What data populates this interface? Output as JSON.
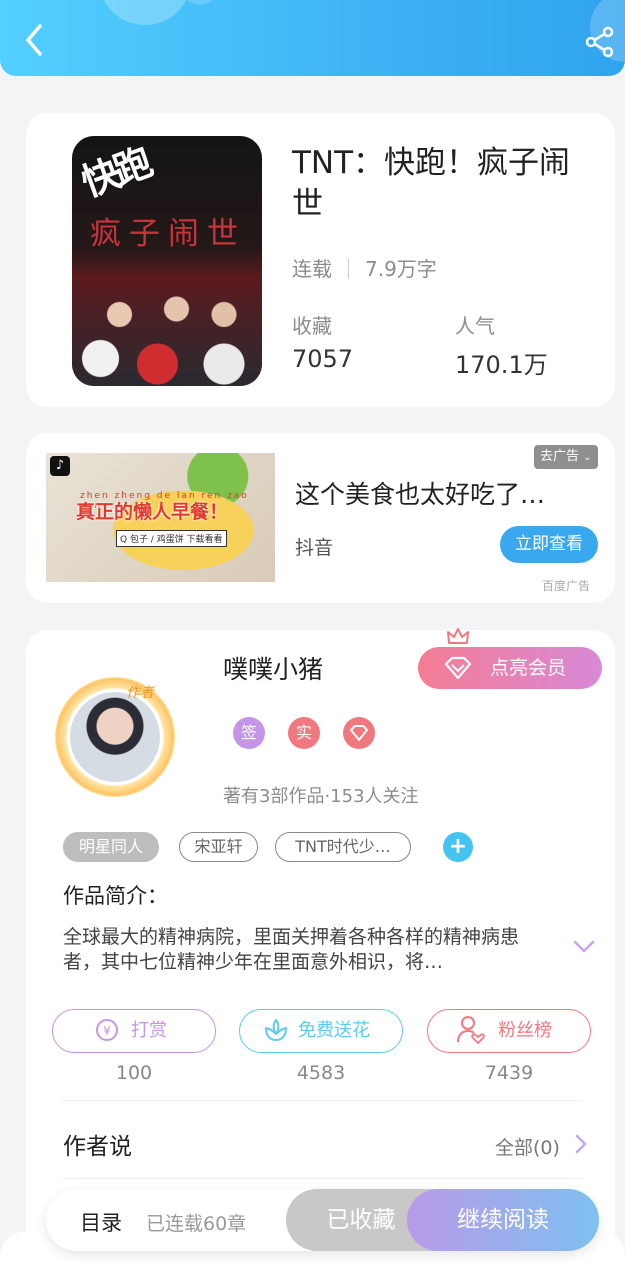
{
  "header": {
    "back_icon": "chevron-left-icon",
    "share_icon": "share-icon",
    "colors": {
      "gradient_start": "#52d0ff",
      "gradient_end": "#2fa3ee"
    }
  },
  "book": {
    "cover_title": "快跑",
    "cover_subtitle": "疯子闹世",
    "title": "TNT：快跑！疯子闹世",
    "status": "连载",
    "word_count": "7.9万字",
    "stats": [
      {
        "label": "收藏",
        "value": "7057"
      },
      {
        "label": "人气",
        "value": "170.1万"
      }
    ]
  },
  "ad": {
    "close_label": "去广告",
    "image_caption": "真正的懒人早餐！",
    "image_pinyin": "zhen zheng de lan ren zao can",
    "image_search": "Q 包子 / 鸡蛋饼  下载看看",
    "title": "这个美食也太好吃了…",
    "source": "抖音",
    "cta_label": "立即查看",
    "footer_label": "百度广告",
    "cta_color": "#3aa8ef"
  },
  "author": {
    "tag_label": "作者",
    "name": "噗噗小猪",
    "vip_label": "点亮会员",
    "badges": [
      {
        "label": "签",
        "color": "#c595e8"
      },
      {
        "label": "实",
        "color": "#f1787f"
      },
      {
        "label": "◆",
        "color": "#f1787f"
      }
    ],
    "meta": "著有3部作品·153人关注"
  },
  "tags": [
    "明星同人",
    "宋亚轩",
    "TNT时代少…"
  ],
  "intro": {
    "label": "作品简介：",
    "text": "全球最大的精神病院，里面关押着各种各样的精神病患者，其中七位精神少年在里面意外相识，将…"
  },
  "actions": [
    {
      "label": "打赏",
      "count": "100",
      "icon": "yen-icon",
      "color": "#c595e8"
    },
    {
      "label": "免费送花",
      "count": "4583",
      "icon": "flower-icon",
      "color": "#5ccbf0"
    },
    {
      "label": "粉丝榜",
      "count": "7439",
      "icon": "user-heart-icon",
      "color": "#f1787f"
    }
  ],
  "author_says": {
    "label": "作者说",
    "all_label": "全部(0)"
  },
  "bottom_bar": {
    "toc_label": "目录",
    "toc_count": "已连载60章",
    "fav_label": "已收藏",
    "read_label": "继续阅读"
  }
}
